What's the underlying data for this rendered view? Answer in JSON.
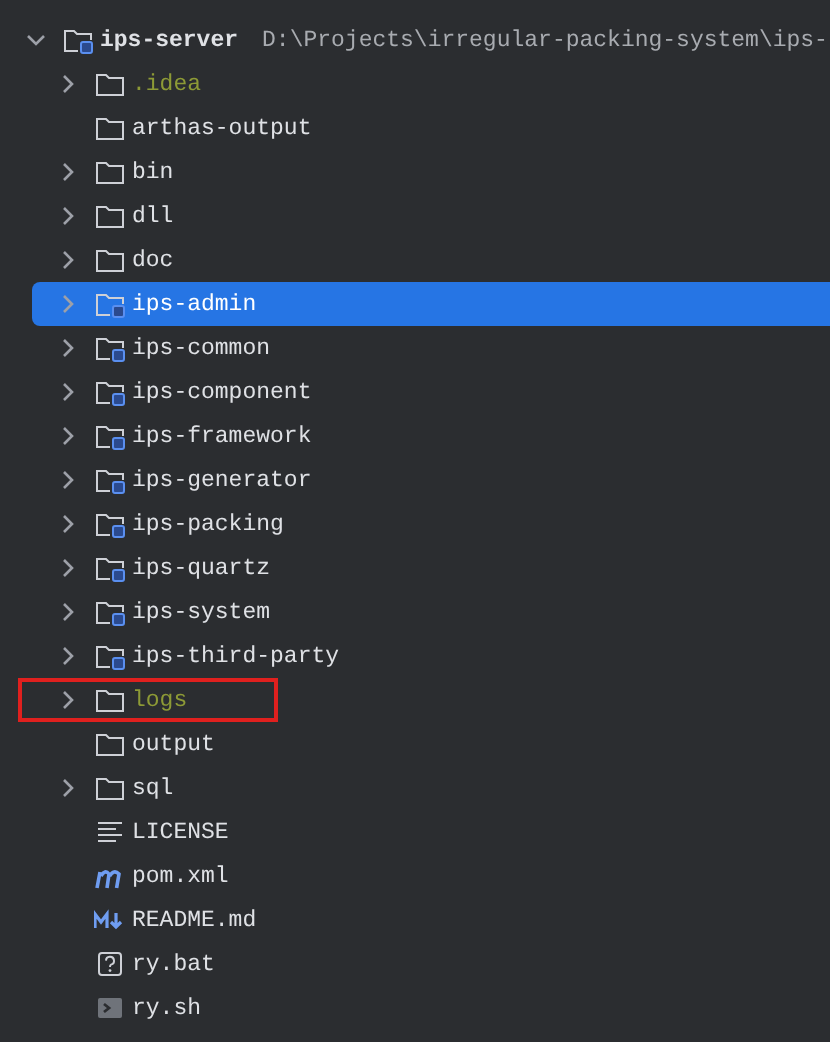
{
  "root": {
    "name": "ips-server",
    "path": "D:\\Projects\\irregular-packing-system\\ips-",
    "expanded": true
  },
  "items": [
    {
      "name": ".idea",
      "kind": "folder",
      "expandable": true,
      "selected": false,
      "excluded": true,
      "highlighted": false
    },
    {
      "name": "arthas-output",
      "kind": "folder",
      "expandable": false,
      "selected": false,
      "excluded": false,
      "highlighted": false
    },
    {
      "name": "bin",
      "kind": "folder",
      "expandable": true,
      "selected": false,
      "excluded": false,
      "highlighted": false
    },
    {
      "name": "dll",
      "kind": "folder",
      "expandable": true,
      "selected": false,
      "excluded": false,
      "highlighted": false
    },
    {
      "name": "doc",
      "kind": "folder",
      "expandable": true,
      "selected": false,
      "excluded": false,
      "highlighted": false
    },
    {
      "name": "ips-admin",
      "kind": "module",
      "expandable": true,
      "selected": true,
      "excluded": false,
      "highlighted": false
    },
    {
      "name": "ips-common",
      "kind": "module",
      "expandable": true,
      "selected": false,
      "excluded": false,
      "highlighted": false
    },
    {
      "name": "ips-component",
      "kind": "module",
      "expandable": true,
      "selected": false,
      "excluded": false,
      "highlighted": false
    },
    {
      "name": "ips-framework",
      "kind": "module",
      "expandable": true,
      "selected": false,
      "excluded": false,
      "highlighted": false
    },
    {
      "name": "ips-generator",
      "kind": "module",
      "expandable": true,
      "selected": false,
      "excluded": false,
      "highlighted": false
    },
    {
      "name": "ips-packing",
      "kind": "module",
      "expandable": true,
      "selected": false,
      "excluded": false,
      "highlighted": false
    },
    {
      "name": "ips-quartz",
      "kind": "module",
      "expandable": true,
      "selected": false,
      "excluded": false,
      "highlighted": false
    },
    {
      "name": "ips-system",
      "kind": "module",
      "expandable": true,
      "selected": false,
      "excluded": false,
      "highlighted": false
    },
    {
      "name": "ips-third-party",
      "kind": "module",
      "expandable": true,
      "selected": false,
      "excluded": false,
      "highlighted": false
    },
    {
      "name": "logs",
      "kind": "folder",
      "expandable": true,
      "selected": false,
      "excluded": true,
      "highlighted": true
    },
    {
      "name": "output",
      "kind": "folder",
      "expandable": false,
      "selected": false,
      "excluded": false,
      "highlighted": false
    },
    {
      "name": "sql",
      "kind": "folder",
      "expandable": true,
      "selected": false,
      "excluded": false,
      "highlighted": false
    },
    {
      "name": "LICENSE",
      "kind": "text",
      "expandable": false,
      "selected": false,
      "excluded": false,
      "highlighted": false
    },
    {
      "name": "pom.xml",
      "kind": "maven",
      "expandable": false,
      "selected": false,
      "excluded": false,
      "highlighted": false
    },
    {
      "name": "README.md",
      "kind": "markdown",
      "expandable": false,
      "selected": false,
      "excluded": false,
      "highlighted": false
    },
    {
      "name": "ry.bat",
      "kind": "unknown",
      "expandable": false,
      "selected": false,
      "excluded": false,
      "highlighted": false
    },
    {
      "name": "ry.sh",
      "kind": "shell",
      "expandable": false,
      "selected": false,
      "excluded": false,
      "highlighted": false
    }
  ]
}
